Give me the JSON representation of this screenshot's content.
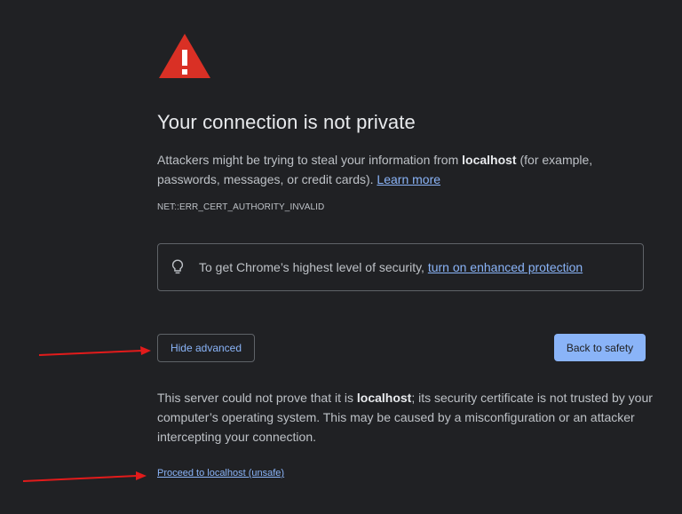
{
  "title": "Your connection is not private",
  "description": {
    "before_host": "Attackers might be trying to steal your information from ",
    "host": "localhost",
    "after_host": " (for example, passwords, messages, or credit cards). ",
    "learn_more": "Learn more"
  },
  "error_code": "NET::ERR_CERT_AUTHORITY_INVALID",
  "enhanced": {
    "text": "To get Chrome’s highest level of security, ",
    "link": "turn on enhanced protection"
  },
  "buttons": {
    "hide_advanced": "Hide advanced",
    "back_to_safety": "Back to safety"
  },
  "details": {
    "before_host": "This server could not prove that it is ",
    "host": "localhost",
    "after_host": "; its security certificate is not trusted by your computer’s operating system. This may be caused by a misconfiguration or an attacker intercepting your connection."
  },
  "proceed_link": "Proceed to localhost (unsafe)",
  "icons": {
    "warning": "warning-triangle-icon",
    "bulb": "lightbulb-icon",
    "arrow": "red-arrow-annotation"
  },
  "colors": {
    "background": "#202124",
    "warning_red": "#d93025",
    "link_blue": "#8ab4f8",
    "annotation_red": "#e21b1b"
  }
}
